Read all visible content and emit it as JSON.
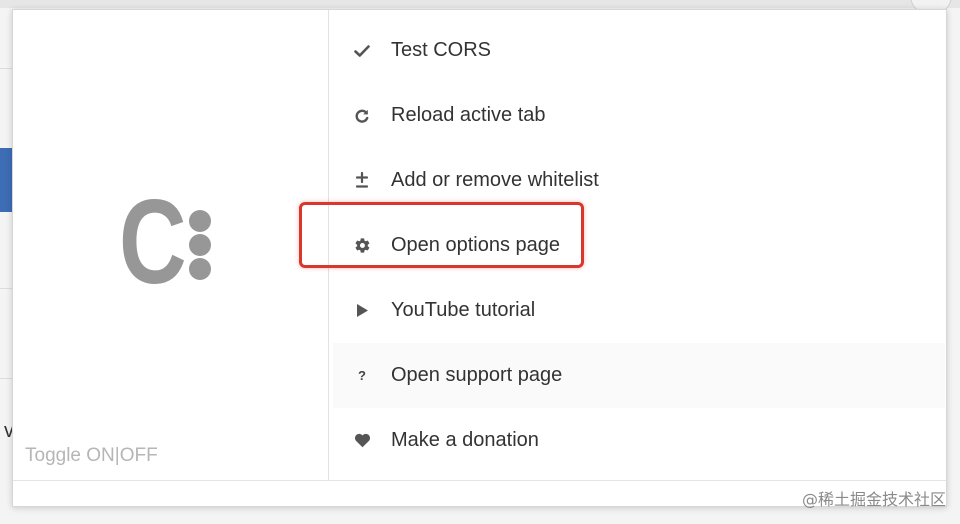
{
  "toggle": {
    "label": "Toggle ON|OFF"
  },
  "menu": {
    "items": [
      {
        "label": "Test CORS",
        "icon": "check-icon"
      },
      {
        "label": "Reload active tab",
        "icon": "reload-icon"
      },
      {
        "label": "Add or remove whitelist",
        "icon": "plus-minus-icon"
      },
      {
        "label": "Open options page",
        "icon": "gear-icon",
        "highlighted": true
      },
      {
        "label": "YouTube tutorial",
        "icon": "play-icon"
      },
      {
        "label": "Open support page",
        "icon": "question-icon"
      },
      {
        "label": "Make a donation",
        "icon": "heart-icon"
      }
    ]
  },
  "watermark": "@稀土掘金技术社区",
  "colors": {
    "logo": "#979797",
    "highlight": "#d8372c",
    "text": "#333333",
    "muted": "#b6b6b6"
  }
}
